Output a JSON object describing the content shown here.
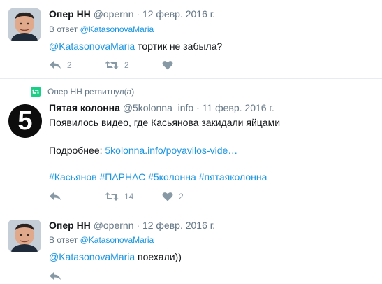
{
  "tweets": [
    {
      "name": "Опер НН",
      "handle": "@opernn",
      "dot": "·",
      "date": "12 февр. 2016 г.",
      "reply_prefix": "В ответ",
      "reply_to": "@KatasonovaMaria",
      "mention": "@KatasonovaMaria",
      "text": " тортик не забыла?",
      "reply_count": "2",
      "retweet_count": "2",
      "like_count": ""
    },
    {
      "retweet_context": "Опер НН ретвитнул(а)",
      "avatar_glyph": "5",
      "name": "Пятая колонна",
      "handle": "@5kolonna_info",
      "dot": "·",
      "date": "11 февр. 2016 г.",
      "line1": "Появилось видео, где Касьянова закидали яйцами",
      "more_label": "Подробнее: ",
      "more_link": "5kolonna.info/poyavilos-vide…",
      "hashtags": "#Касьянов #ПАРНАС #5колонна #пятаяколонна",
      "reply_count": "",
      "retweet_count": "14",
      "like_count": "2"
    },
    {
      "name": "Опер НН",
      "handle": "@opernn",
      "dot": "·",
      "date": "12 февр. 2016 г.",
      "reply_prefix": "В ответ",
      "reply_to": "@KatasonovaMaria",
      "mention": "@KatasonovaMaria",
      "text": " поехали))"
    }
  ],
  "colors": {
    "link": "#1b95e0",
    "muted": "#657786",
    "icon": "#8899a6",
    "retweet_green": "#19cf86"
  },
  "icons": [
    "reply-icon",
    "retweet-icon",
    "heart-icon",
    "retweet-badge-icon"
  ]
}
